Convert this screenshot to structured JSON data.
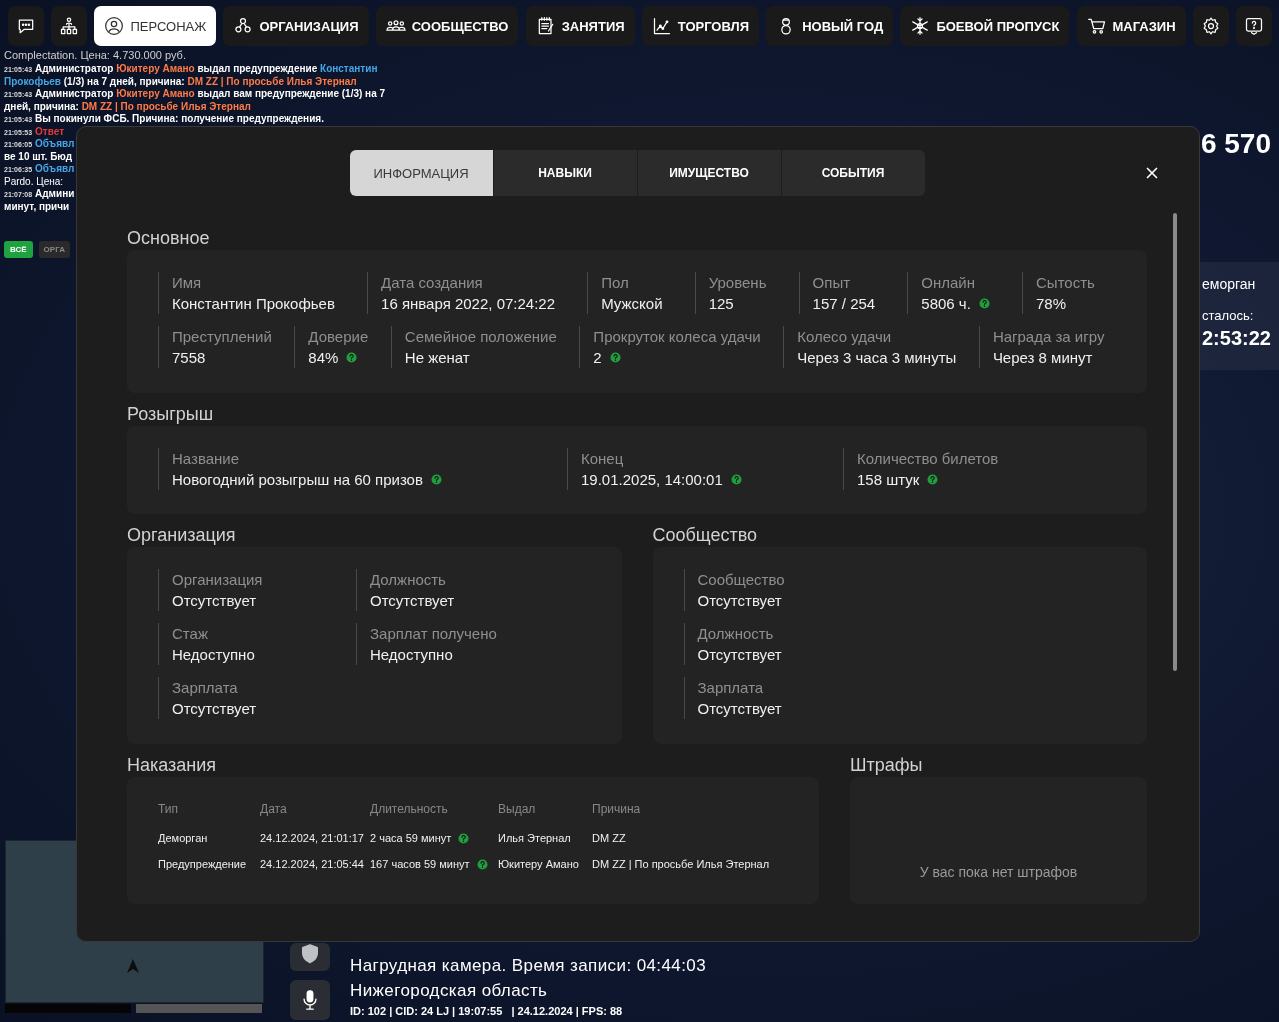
{
  "nav": [
    {
      "selected": false
    },
    {
      "selected": false
    },
    {
      "label": "ПЕРСОНАЖ",
      "selected": true
    },
    {
      "label": "ОРГАНИЗАЦИЯ",
      "selected": false
    },
    {
      "label": "СООБЩЕСТВО",
      "selected": false
    },
    {
      "label": "ЗАНЯТИЯ",
      "selected": false
    },
    {
      "label": "ТОРГОВЛЯ",
      "selected": false
    },
    {
      "label": "НОВЫЙ ГОД",
      "selected": false
    },
    {
      "label": "БОЕВОЙ ПРОПУСК",
      "selected": false
    },
    {
      "label": "МАГАЗИН",
      "selected": false
    },
    {
      "selected": false
    },
    {
      "selected": false
    }
  ],
  "chat": {
    "header": "Complectation. Цена: 4.730.000 руб.",
    "lines": [
      {
        "time": "21:05:43",
        "parts": [
          {
            "kind": "text",
            "text": "Администратор "
          },
          {
            "kind": "accent",
            "text": "Юкитеру Амано"
          },
          {
            "kind": "text",
            "text": " выдал предупреждение "
          },
          {
            "kind": "link",
            "text": "Константин"
          }
        ]
      },
      {
        "parts": [
          {
            "kind": "link",
            "text": "Прокофьев"
          },
          {
            "kind": "text",
            "text": " (1/3) на 7 дней, причина: "
          },
          {
            "kind": "accent",
            "text": "DM ZZ | По просьбе Илья Этернал"
          }
        ]
      },
      {
        "time": "21:05:43",
        "parts": [
          {
            "kind": "text",
            "text": "Администратор "
          },
          {
            "kind": "accent",
            "text": "Юкитеру Амано"
          },
          {
            "kind": "text",
            "text": " выдал вам предупреждение (1/3) на 7"
          }
        ]
      },
      {
        "parts": [
          {
            "kind": "text",
            "text": "дней, причина: "
          },
          {
            "kind": "accent",
            "text": "DM ZZ | По просьбе Илья Этернал"
          }
        ]
      },
      {
        "time": "21:05:43",
        "parts": [
          {
            "kind": "text",
            "text": "Вы покинули ФСБ. Причина: получение предупреждения."
          }
        ]
      },
      {
        "time": "21:05:53",
        "parts": [
          {
            "kind": "alert",
            "text": "Ответ"
          }
        ]
      },
      {
        "time": "21:06:05",
        "parts": [
          {
            "kind": "link",
            "text": "Объявл"
          }
        ]
      },
      {
        "parts": [
          {
            "kind": "text",
            "text": "ве 10 шт. Бюд"
          }
        ]
      },
      {
        "time": "21:06:35",
        "parts": [
          {
            "kind": "link",
            "text": "Объявл"
          }
        ]
      },
      {
        "parts": [
          {
            "kind": "plain",
            "text": "Pardo. Цена:"
          }
        ]
      },
      {
        "time": "21:07:08",
        "parts": [
          {
            "kind": "text",
            "text": "Админи"
          }
        ]
      },
      {
        "parts": [
          {
            "kind": "text",
            "text": "минут, причи"
          }
        ]
      }
    ],
    "filters": [
      {
        "label": "ВСЁ",
        "selected": true
      },
      {
        "label": "ОРГА",
        "selected": false
      }
    ]
  },
  "hud": {
    "money": "6 570",
    "status": "еморган",
    "remaining_label": "сталось:",
    "remaining": "2:53:22"
  },
  "dialog": {
    "tabs": [
      {
        "label": "ИНФОРМАЦИЯ",
        "selected": true
      },
      {
        "label": "НАВЫКИ",
        "selected": false
      },
      {
        "label": "ИМУЩЕСТВО",
        "selected": false
      },
      {
        "label": "СОБЫТИЯ",
        "selected": false
      }
    ],
    "main": {
      "title": "Основное",
      "lines": [
        {
          "fields": [
            {
              "label": "Имя",
              "value": "Константин Прокофьев",
              "help": false
            },
            {
              "label": "Дата создания",
              "value": "16 января 2022, 07:24:22",
              "help": false
            },
            {
              "label": "Пол",
              "value": "Мужской",
              "help": false
            },
            {
              "label": "Уровень",
              "value": "125",
              "help": false
            },
            {
              "label": "Опыт",
              "value": "157 / 254",
              "help": false
            },
            {
              "label": "Онлайн",
              "value": "5806 ч.",
              "help": true
            },
            {
              "label": "Сытость",
              "value": "78%",
              "help": false
            }
          ]
        },
        {
          "fields": [
            {
              "label": "Преступлений",
              "value": "7558",
              "help": false
            },
            {
              "label": "Доверие",
              "value": "84%",
              "help": true
            },
            {
              "label": "Семейное положение",
              "value": "Не женат",
              "help": false
            },
            {
              "label": "Прокруток колеса удачи",
              "value": "2",
              "help": true
            },
            {
              "label": "Колесо удачи",
              "value": "Через 3 часа 3 минуты",
              "help": false
            },
            {
              "label": "Награда за игру",
              "value": "Через 8 минут",
              "help": false
            }
          ]
        }
      ]
    },
    "raffle": {
      "title": "Розыгрыш",
      "fields": [
        {
          "label": "Название",
          "value": "Новогодний розыгрыш на 60 призов",
          "help": true
        },
        {
          "label": "Конец",
          "value": "19.01.2025, 14:00:01",
          "help": true
        },
        {
          "label": "Количество билетов",
          "value": "158 штук",
          "help": true
        }
      ]
    },
    "organization": {
      "title": "Организация",
      "fields": [
        {
          "label": "Организация",
          "value": "Отсутствует",
          "help": false
        },
        {
          "label": "Должность",
          "value": "Отсутствует",
          "help": false
        },
        {
          "label": "Стаж",
          "value": "Недоступно",
          "help": false
        },
        {
          "label": "Зарплат получено",
          "value": "Недоступно",
          "help": false
        },
        {
          "label": "Зарплата",
          "value": "Отсутствует",
          "help": false
        }
      ]
    },
    "community": {
      "title": "Сообщество",
      "fields": [
        {
          "label": "Сообщество",
          "value": "Отсутствует",
          "help": false
        },
        {
          "label": "Должность",
          "value": "Отсутствует",
          "help": false
        },
        {
          "label": "Зарплата",
          "value": "Отсутствует",
          "help": false
        }
      ]
    },
    "punishments": {
      "title": "Наказания",
      "columns": [
        "Тип",
        "Дата",
        "Длительность",
        "Выдал",
        "Причина"
      ],
      "rows": [
        {
          "cells": [
            "Деморган",
            "24.12.2024, 21:01:17",
            "2 часа 59 минут",
            "Илья Этернал",
            "DM ZZ"
          ],
          "help": true
        },
        {
          "cells": [
            "Предупреждение",
            "24.12.2024, 21:05:44",
            "167 часов 59 минут",
            "Юкитеру Амано",
            "DM ZZ | По просьбе Илья Этернал"
          ],
          "help": true
        }
      ]
    },
    "fines": {
      "title": "Штрафы",
      "empty": "У вас пока нет штрафов"
    }
  },
  "bodycam": {
    "title": "Нагрудная камера. Время записи: 04:44:03",
    "region": "Нижегородская область",
    "info": "ID: 102 | CID: 24 LJ | 19:07:55   | 24.12.2024 | FPS: 88"
  }
}
